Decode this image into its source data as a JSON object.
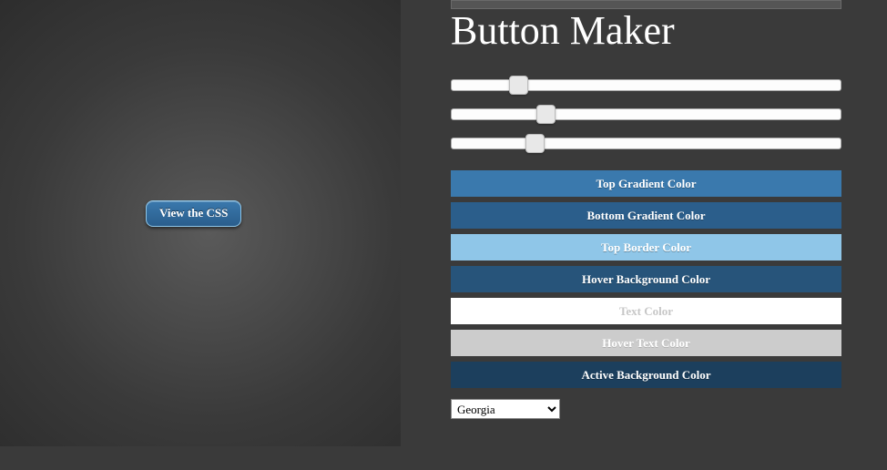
{
  "preview": {
    "button_label": "View the CSS"
  },
  "title": "Button Maker",
  "sliders": [
    {
      "position_pct": 15
    },
    {
      "position_pct": 22
    },
    {
      "position_pct": 19
    }
  ],
  "color_buttons": [
    {
      "label": "Top Gradient Color",
      "swatch": "#3a79ad"
    },
    {
      "label": "Bottom Gradient Color",
      "swatch": "#2b5e8b"
    },
    {
      "label": "Top Border Color",
      "swatch": "#8fc6e8"
    },
    {
      "label": "Hover Background Color",
      "swatch": "#27547a"
    },
    {
      "label": "Text Color",
      "swatch": "#ffffff"
    },
    {
      "label": "Hover Text Color",
      "swatch": "#cccccc"
    },
    {
      "label": "Active Background Color",
      "swatch": "#1c3f5d"
    }
  ],
  "font_select": {
    "selected": "Georgia"
  }
}
